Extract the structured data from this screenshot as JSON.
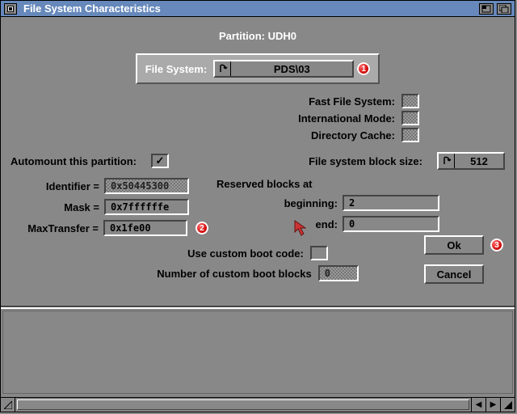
{
  "window": {
    "title": "File System Characteristics"
  },
  "partition": {
    "label": "Partition:",
    "name": "UDH0"
  },
  "filesystem": {
    "label": "File System:",
    "value": "PDS\\03"
  },
  "flags": {
    "fast_fs": {
      "label": "Fast File System:",
      "checked": false,
      "disabled": true
    },
    "intl": {
      "label": "International Mode:",
      "checked": false,
      "disabled": true
    },
    "dircache": {
      "label": "Directory Cache:",
      "checked": false,
      "disabled": true
    }
  },
  "automount": {
    "label": "Automount this partition:",
    "checked": true
  },
  "blocksize": {
    "label": "File system block size:",
    "value": "512"
  },
  "left_fields": {
    "identifier": {
      "label": "Identifier =",
      "value": "0x50445300",
      "disabled": true
    },
    "mask": {
      "label": "Mask =",
      "value": "0x7ffffffe"
    },
    "maxtransfer": {
      "label": "MaxTransfer =",
      "value": "0x1fe00"
    }
  },
  "reserved": {
    "header": "Reserved blocks at",
    "beginning": {
      "label": "beginning:",
      "value": "2"
    },
    "end": {
      "label": "end:",
      "value": "0"
    }
  },
  "custom_boot": {
    "use_label": "Use custom boot code:",
    "use_checked": false,
    "num_label": "Number of custom boot blocks",
    "num_value": "0",
    "num_disabled": true
  },
  "buttons": {
    "ok": "Ok",
    "cancel": "Cancel"
  },
  "markers": {
    "m1": "1",
    "m2": "2",
    "m3": "3"
  }
}
